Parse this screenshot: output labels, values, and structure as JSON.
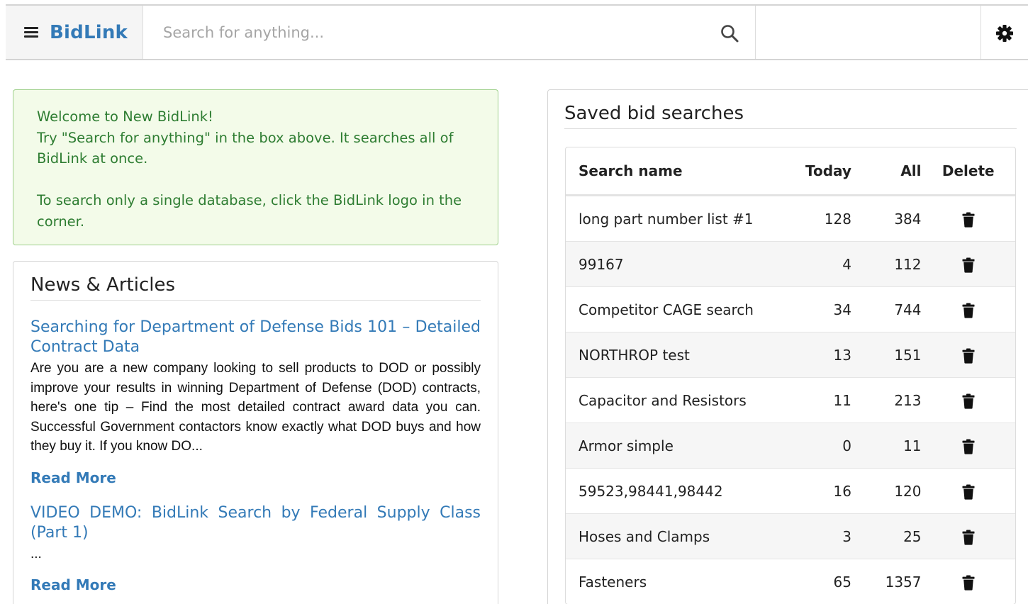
{
  "nav": {
    "brand": "BidLink",
    "search_placeholder": "Search for anything..."
  },
  "welcome": {
    "line1": "Welcome to New BidLink!",
    "line2": "Try \"Search for anything\" in the box above. It searches all of BidLink at once.",
    "line3": "To search only a single database, click the BidLink logo in the corner."
  },
  "news": {
    "title": "News & Articles",
    "articles": [
      {
        "title": "Searching for Department of Defense Bids 101 – Detailed Contract Data",
        "summary": "Are you are a new company looking to sell products to DOD or possibly improve your results in winning Department of Defense (DOD) contracts, here's one tip – Find the most detailed contract award data you can. Successful Government contactors know exactly what DOD buys and how they buy it. If you know DO...",
        "read_more": "Read More"
      },
      {
        "title": "VIDEO DEMO: BidLink Search by Federal Supply Class (Part 1)",
        "summary": "...",
        "read_more": "Read More"
      }
    ]
  },
  "saved": {
    "title": "Saved bid searches",
    "headers": {
      "name": "Search name",
      "today": "Today",
      "all": "All",
      "delete": "Delete"
    },
    "rows": [
      {
        "name": "long part number list #1",
        "today": "128",
        "all": "384"
      },
      {
        "name": "99167",
        "today": "4",
        "all": "112"
      },
      {
        "name": "Competitor CAGE search",
        "today": "34",
        "all": "744"
      },
      {
        "name": "NORTHROP test",
        "today": "13",
        "all": "151"
      },
      {
        "name": "Capacitor and Resistors",
        "today": "11",
        "all": "213"
      },
      {
        "name": "Armor simple",
        "today": "0",
        "all": "11"
      },
      {
        "name": "59523,98441,98442",
        "today": "16",
        "all": "120"
      },
      {
        "name": "Hoses and Clamps",
        "today": "3",
        "all": "25"
      },
      {
        "name": "Fasteners",
        "today": "65",
        "all": "1357"
      }
    ]
  },
  "colors": {
    "brand": "#337ab7",
    "alert_text": "#2e7d32",
    "alert_bg": "#f3fbe9",
    "alert_border": "#9fd08c"
  },
  "icons": {
    "menu": "hamburger-icon",
    "search": "search-icon",
    "settings": "gear-icon",
    "delete": "trash-icon"
  }
}
